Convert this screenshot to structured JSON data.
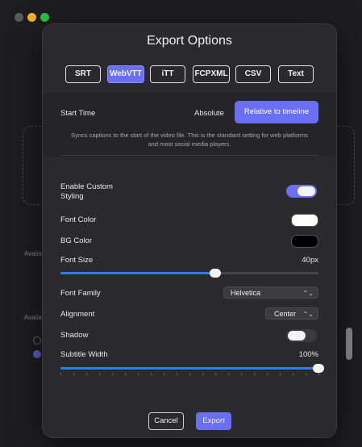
{
  "background": {
    "labels": [
      "Availa",
      "Availa"
    ]
  },
  "dialog": {
    "title": "Export Options",
    "formats": [
      {
        "label": "SRT",
        "selected": false
      },
      {
        "label": "WebVTT",
        "selected": true
      },
      {
        "label": "iTT",
        "selected": false
      },
      {
        "label": "FCPXML",
        "selected": false
      },
      {
        "label": "CSV",
        "selected": false
      },
      {
        "label": "Text",
        "selected": false
      }
    ],
    "start_time": {
      "label": "Start Time",
      "option_absolute": "Absolute",
      "option_relative": "Relative to timeline",
      "selected": "Relative to timeline",
      "hint": "Syncs captions to the start of the video file. This is the standard setting for web platforms and most social media players."
    },
    "styling": {
      "enable_label": "Enable Custom Styling",
      "enable_on": true,
      "font_color_label": "Font Color",
      "font_color": "#ffffff",
      "bg_color_label": "BG Color",
      "bg_color": "#000000",
      "font_size_label": "Font Size",
      "font_size_value": "40px",
      "font_size_fraction": 0.6,
      "font_family_label": "Font Family",
      "font_family_value": "Helvetica",
      "alignment_label": "Alignment",
      "alignment_value": "Center",
      "shadow_label": "Shadow",
      "shadow_on": false,
      "subtitle_width_label": "Subtitle Width",
      "subtitle_width_value": "100%",
      "subtitle_width_fraction": 1.0
    },
    "buttons": {
      "cancel": "Cancel",
      "export": "Export"
    }
  },
  "colors": {
    "accent": "#6a6ff5",
    "slider_fill": "#2f7bf6"
  }
}
